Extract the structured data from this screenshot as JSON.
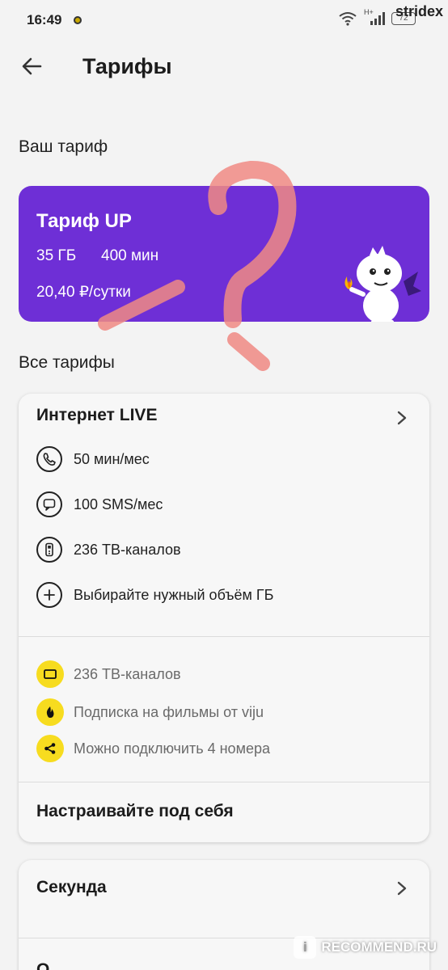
{
  "status_bar": {
    "time": "16:49",
    "battery": "72",
    "network": "H+"
  },
  "watermark": {
    "top": "stridex",
    "bottom": "RECOMMEND.RU",
    "badge": "i"
  },
  "header": {
    "title": "Тарифы"
  },
  "current": {
    "section_label": "Ваш тариф",
    "name": "Тариф UP",
    "data": "35 ГБ",
    "minutes": "400 мин",
    "price": "20,40 ₽/сутки",
    "card_color": "#6e2fd6"
  },
  "all": {
    "section_label": "Все тарифы",
    "plans": [
      {
        "name": "Интернет LIVE",
        "features": [
          {
            "icon": "phone-icon",
            "text": "50 мин/мес"
          },
          {
            "icon": "sms-icon",
            "text": "100 SMS/мес"
          },
          {
            "icon": "tv-remote-icon",
            "text": "236 ТВ-каналов"
          },
          {
            "icon": "plus-icon",
            "text": "Выбирайте нужный объём ГБ"
          }
        ],
        "perks": [
          {
            "icon": "tv-icon",
            "text": "236 ТВ-каналов"
          },
          {
            "icon": "flame-icon",
            "text": "Подписка на фильмы от viju"
          },
          {
            "icon": "share-icon",
            "text": "Можно подключить 4 номера"
          }
        ],
        "customize": "Настраивайте под себя"
      },
      {
        "name": "Секунда"
      }
    ],
    "next_plan_partial": "О"
  },
  "colors": {
    "accent": "#6e2fd6",
    "perk": "#f7dc1f",
    "overlay": "#f08a84"
  }
}
